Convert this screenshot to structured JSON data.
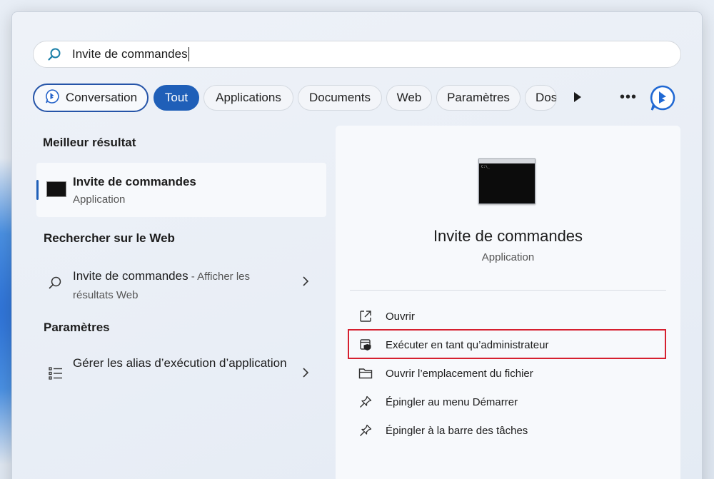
{
  "search": {
    "query": "Invite de commandes"
  },
  "filters": {
    "conversation": "Conversation",
    "tabs": [
      "Tout",
      "Applications",
      "Documents",
      "Web",
      "Paramètres",
      "Dos"
    ]
  },
  "best_match": {
    "section_title": "Meilleur résultat",
    "title": "Invite de commandes",
    "subtitle": "Application"
  },
  "web_search": {
    "section_title": "Rechercher sur le Web",
    "query": "Invite de commandes",
    "suffix": " - Afficher les résultats Web"
  },
  "settings": {
    "section_title": "Paramètres",
    "item_label": "Gérer les alias d’exécution d’application"
  },
  "detail": {
    "title": "Invite de commandes",
    "subtitle": "Application",
    "actions": [
      "Ouvrir",
      "Exécuter en tant qu’administrateur",
      "Ouvrir l’emplacement du fichier",
      "Épingler au menu Démarrer",
      "Épingler à la barre des tâches"
    ]
  },
  "colors": {
    "accent": "#1f5fb8",
    "highlight_border": "#d6202f"
  }
}
